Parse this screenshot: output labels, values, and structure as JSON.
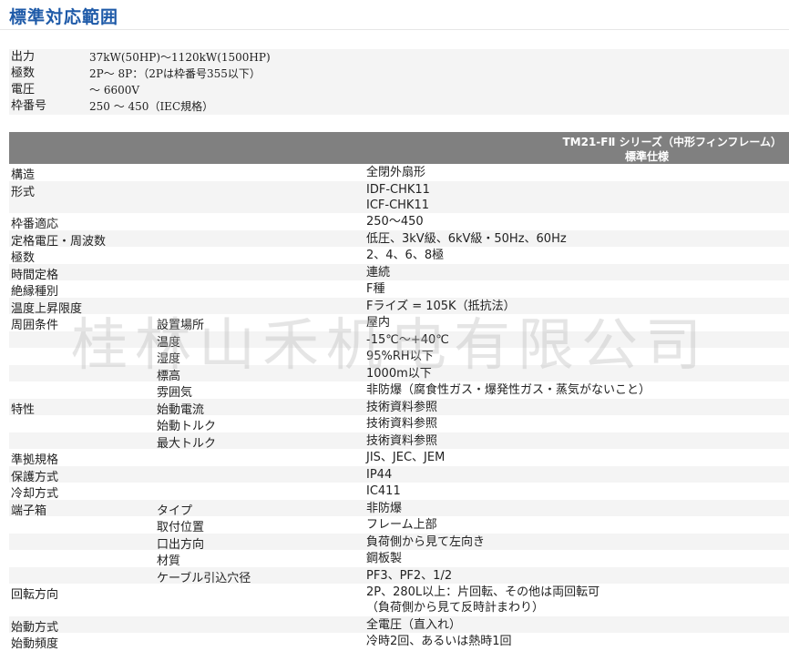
{
  "title": "標準対応範囲",
  "summary": [
    {
      "label": "出力",
      "value": "37kW(50HP)～1120kW(1500HP)"
    },
    {
      "label": "極数",
      "value": "2P～ 8P：（2Pは枠番号355以下）"
    },
    {
      "label": "電圧",
      "value": "～ 6600V"
    },
    {
      "label": "枠番号",
      "value": "250 ～ 450（IEC規格）"
    }
  ],
  "spec_header": {
    "series": "TM21-FⅡ シリーズ（中形フィンフレーム）",
    "column": "標準仕様"
  },
  "watermark": "桂林山禾机电有限公司",
  "rows": [
    {
      "c1": "構造",
      "c2": "",
      "c3": [
        "全閉外扇形"
      ]
    },
    {
      "c1": "形式",
      "c2": "",
      "c3": [
        "IDF-CHK11",
        "ICF-CHK11"
      ]
    },
    {
      "c1": "枠番適応",
      "c2": "",
      "c3": [
        "250～450"
      ]
    },
    {
      "c1": "定格電圧・周波数",
      "c2": "",
      "c3": [
        "低圧、3kV級、6kV級・50Hz、60Hz"
      ]
    },
    {
      "c1": "極数",
      "c2": "",
      "c3": [
        "2、4、6、8極"
      ]
    },
    {
      "c1": "時間定格",
      "c2": "",
      "c3": [
        "連続"
      ]
    },
    {
      "c1": "絶縁種別",
      "c2": "",
      "c3": [
        "F種"
      ]
    },
    {
      "c1": "温度上昇限度",
      "c2": "",
      "c3": [
        "Fライズ = 105K（抵抗法）"
      ]
    },
    {
      "c1": "周囲条件",
      "c2": "設置場所",
      "c3": [
        "屋内"
      ]
    },
    {
      "c1": "",
      "c2": "温度",
      "c3": [
        "-15℃～+40℃"
      ]
    },
    {
      "c1": "",
      "c2": "湿度",
      "c3": [
        "95%RH以下"
      ]
    },
    {
      "c1": "",
      "c2": "標高",
      "c3": [
        "1000m以下"
      ]
    },
    {
      "c1": "",
      "c2": "雰囲気",
      "c3": [
        "非防爆（腐食性ガス・爆発性ガス・蒸気がないこと）"
      ]
    },
    {
      "c1": "特性",
      "c2": "始動電流",
      "c3": [
        "技術資料参照"
      ]
    },
    {
      "c1": "",
      "c2": "始動トルク",
      "c3": [
        "技術資料参照"
      ]
    },
    {
      "c1": "",
      "c2": "最大トルク",
      "c3": [
        "技術資料参照"
      ]
    },
    {
      "c1": "準拠規格",
      "c2": "",
      "c3": [
        "JIS、JEC、JEM"
      ]
    },
    {
      "c1": "保護方式",
      "c2": "",
      "c3": [
        "IP44"
      ]
    },
    {
      "c1": "冷却方式",
      "c2": "",
      "c3": [
        "IC411"
      ]
    },
    {
      "c1": "端子箱",
      "c2": "タイプ",
      "c3": [
        "非防爆"
      ]
    },
    {
      "c1": "",
      "c2": "取付位置",
      "c3": [
        "フレーム上部"
      ]
    },
    {
      "c1": "",
      "c2": "口出方向",
      "c3": [
        "負荷側から見て左向き"
      ]
    },
    {
      "c1": "",
      "c2": "材質",
      "c3": [
        "鋼板製"
      ]
    },
    {
      "c1": "",
      "c2": "ケーブル引込穴径",
      "c3": [
        "PF3、PF2、1/2"
      ]
    },
    {
      "c1": "回転方向",
      "c2": "",
      "c3": [
        "2P、280L以上：片回転、その他は両回転可",
        "（負荷側から見て反時計まわり）"
      ]
    },
    {
      "c1": "始動方式",
      "c2": "",
      "c3": [
        "全電圧（直入れ）"
      ]
    },
    {
      "c1": "始動頻度",
      "c2": "",
      "c3": [
        "冷時2回、あるいは熱時1回"
      ]
    }
  ]
}
